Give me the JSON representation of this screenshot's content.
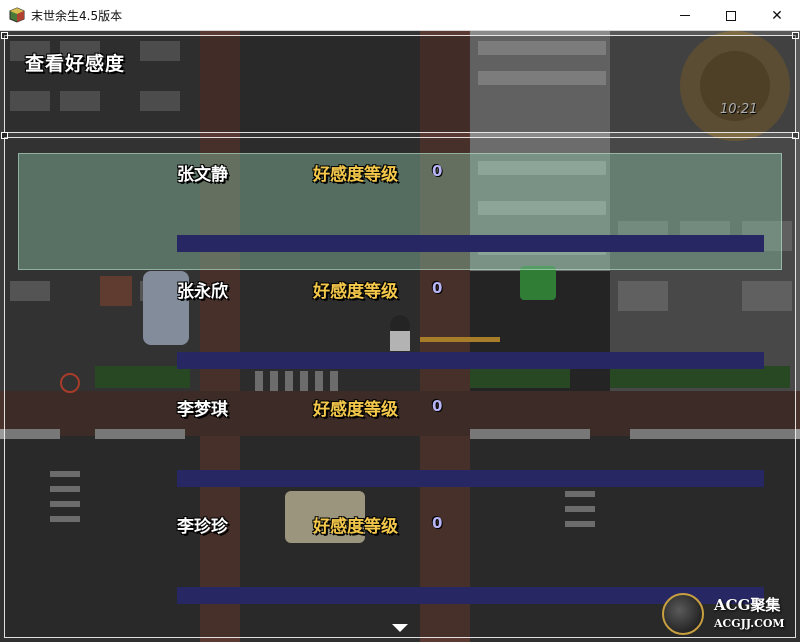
{
  "window": {
    "title": "末世余生4.5版本",
    "icon": "game-app-icon",
    "controls": {
      "minimize_icon": "minimize-icon",
      "maximize_icon": "maximize-icon",
      "close_glyph": "✕"
    }
  },
  "screen": {
    "title": "查看好感度",
    "clock": "10:21"
  },
  "affection": {
    "label": "好感度等级",
    "selected_index": 0,
    "rows": [
      {
        "name": "张文静",
        "label": "好感度等级",
        "level": "0",
        "fill": 0
      },
      {
        "name": "张永欣",
        "label": "好感度等级",
        "level": "0",
        "fill": 0
      },
      {
        "name": "李梦琪",
        "label": "好感度等级",
        "level": "0",
        "fill": 0
      },
      {
        "name": "李珍珍",
        "label": "好感度等级",
        "level": "0",
        "fill": 0
      }
    ],
    "more_indicator": "scroll-down-arrow-icon"
  },
  "watermark": {
    "line1": "ACG聚集",
    "line2": "ACGJJ.COM"
  },
  "colors": {
    "name_text": "#ffffff",
    "label_text": "#f4c84a",
    "value_text": "#b8b4f6",
    "bar_bg": "#272764",
    "highlight": "#8cc8aa"
  }
}
